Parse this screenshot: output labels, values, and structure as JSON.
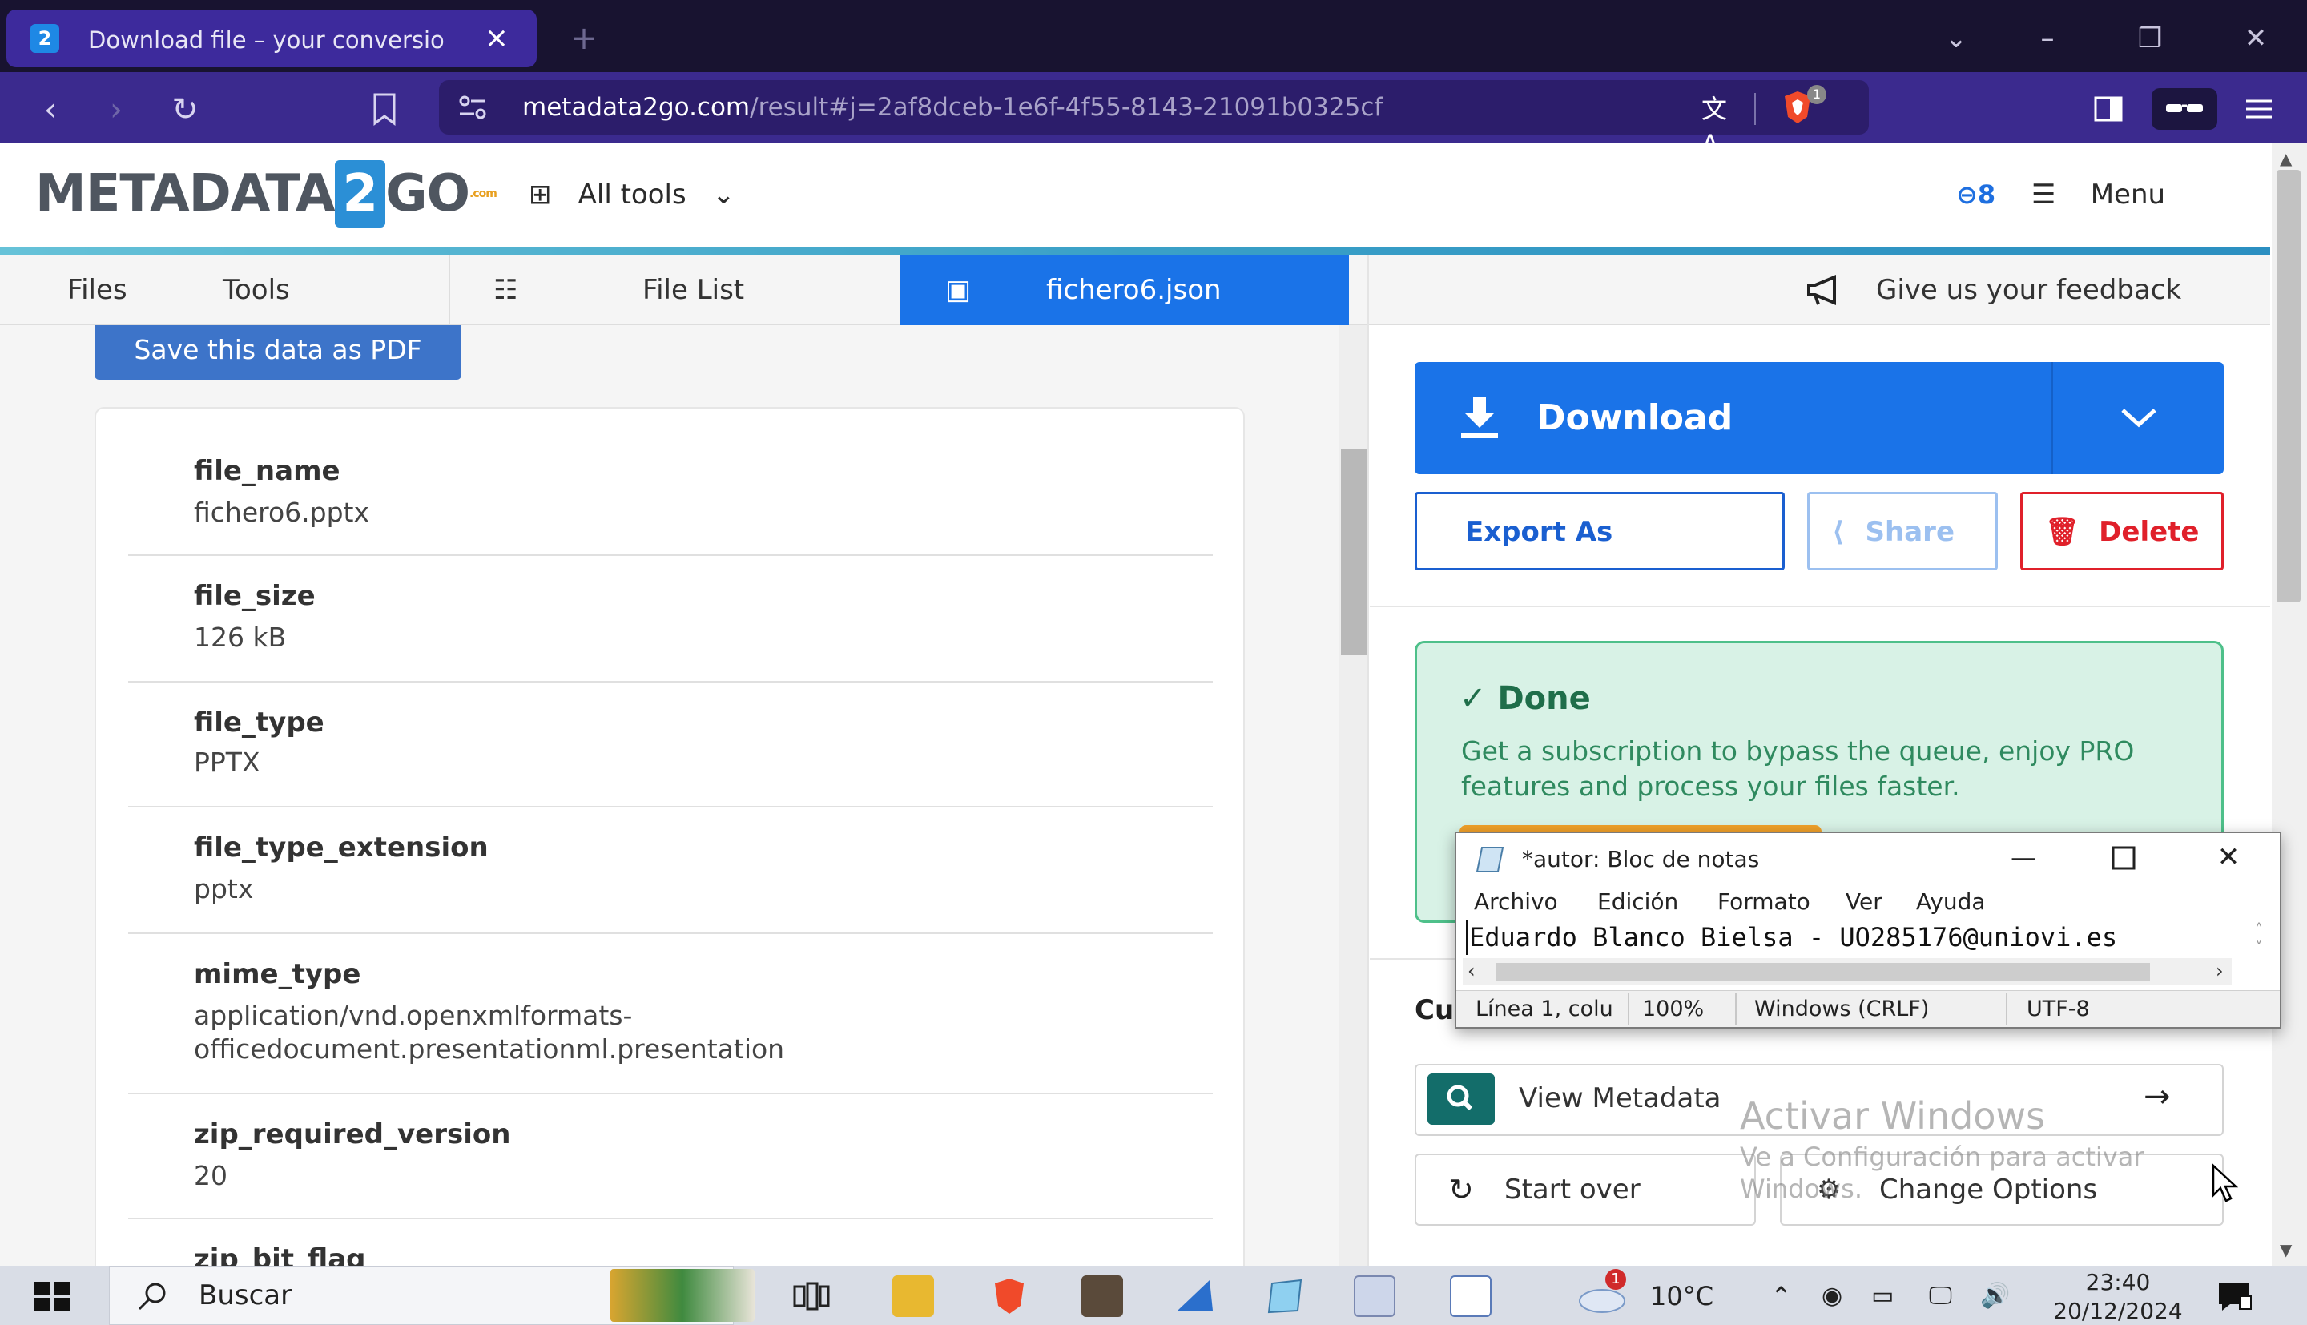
{
  "browser": {
    "tab_title": "Download file – your conversio",
    "tab_favicon": "2",
    "url_host": "metadata2go.com",
    "url_path": "/result#j=2af8dceb-1e6f-4f55-8143-21091b0325cf",
    "shield_badge": "1"
  },
  "site": {
    "logo_left": "METADATA",
    "logo_num": "2",
    "logo_right": "GO",
    "logo_small": ".com",
    "all_tools": "All tools",
    "credits": "8",
    "menu": "Menu",
    "stripe_color": "#3aa0c7"
  },
  "tabs": {
    "files": "Files",
    "tools": "Tools",
    "file_list": "File List",
    "active": "fichero6.json",
    "feedback": "Give us your feedback"
  },
  "left": {
    "save_pdf": "Save this data as PDF",
    "metadata": [
      {
        "key": "file_name",
        "value": "fichero6.pptx"
      },
      {
        "key": "file_size",
        "value": "126 kB"
      },
      {
        "key": "file_type",
        "value": "PPTX"
      },
      {
        "key": "file_type_extension",
        "value": "pptx"
      },
      {
        "key": "mime_type",
        "value": "application/vnd.openxmlformats-",
        "value2": "officedocument.presentationml.presentation"
      },
      {
        "key": "zip_required_version",
        "value": "20"
      },
      {
        "key": "zip_bit_flag",
        "value": ""
      }
    ]
  },
  "right": {
    "download": "Download",
    "export_as": "Export As",
    "share": "Share",
    "delete": "Delete",
    "done_title": "Done",
    "done_msg": "Get a subscription to bypass the queue, enjoy PRO features and process your files faster.",
    "cu_label": "Cu",
    "view_metadata": "View Metadata",
    "start_over": "Start over",
    "change_options": "Change Options",
    "accent": "#1a73e8",
    "delete_color": "#e0202a",
    "done_color": "#d8f2e6"
  },
  "watermark": {
    "line1": "Activar Windows",
    "line2a": "Ve a Configuración para activar",
    "line2b": "Windows."
  },
  "notepad": {
    "title": "*autor: Bloc de notas",
    "menu": [
      "Archivo",
      "Edición",
      "Formato",
      "Ver",
      "Ayuda"
    ],
    "text": "Eduardo Blanco Bielsa - UO285176@uniovi.es",
    "status_pos": "Línea 1, colu",
    "status_zoom": "100%",
    "status_eol": "Windows (CRLF)",
    "status_enc": "UTF-8"
  },
  "taskbar": {
    "search": "Buscar",
    "temperature": "10°C",
    "time": "23:40",
    "date": "20/12/2024",
    "weather_badge": "1"
  }
}
